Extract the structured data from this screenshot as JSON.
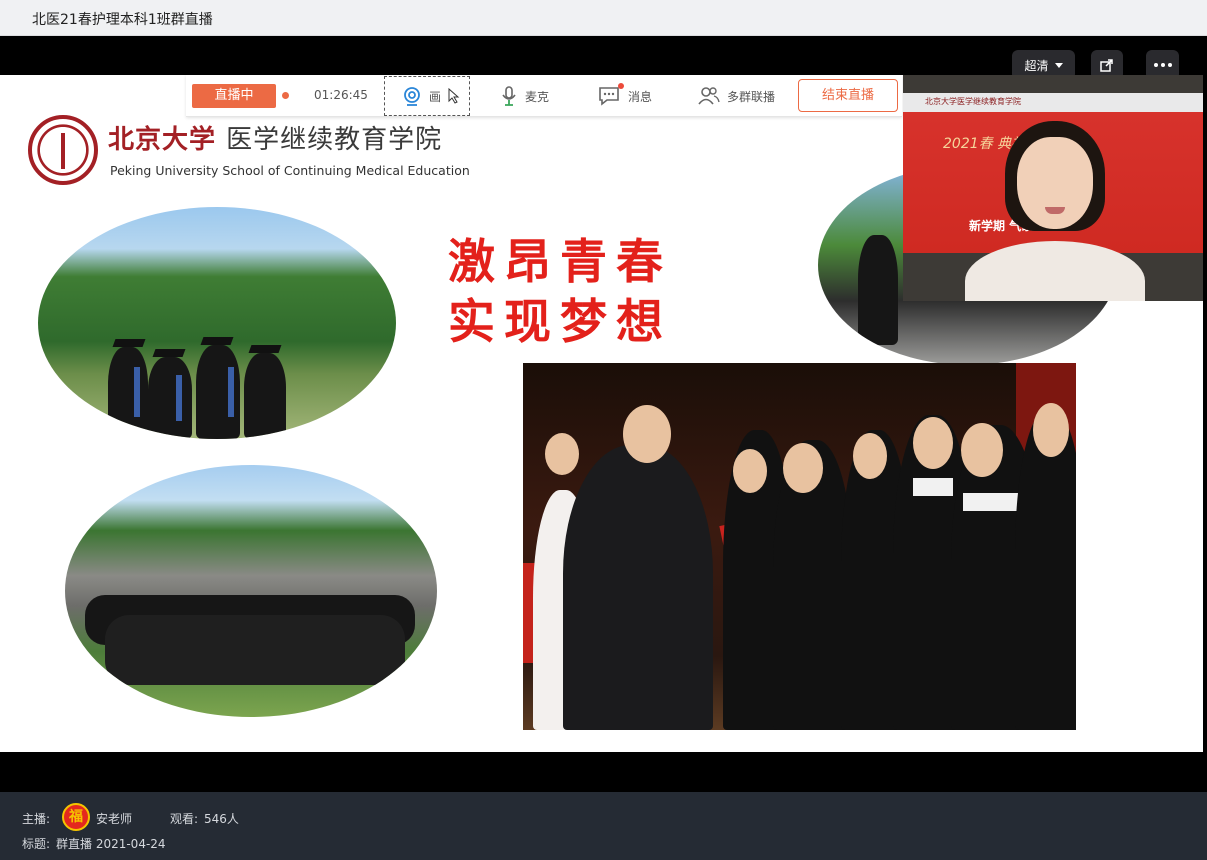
{
  "window": {
    "title": "北医21春护理本科1班群直播"
  },
  "player_controls": {
    "quality_label": "超清",
    "share_icon": "share-window-icon",
    "more_icon": "more-dots-icon"
  },
  "live_toolbar": {
    "status_label": "直播中",
    "elapsed_time": "01:26:45",
    "camera_label": "画",
    "mic_label": "麦克",
    "message_label": "消息",
    "multi_group_label": "多群联播",
    "end_label": "结束直播",
    "accent_color": "#ec6a44"
  },
  "slide": {
    "institution_cn_name": "北京大学",
    "institution_cn_dept": "医学继续教育学院",
    "institution_en": "Peking University School of Continuing Medical Education",
    "slogan_line1": "激昂青春",
    "slogan_line2": "实现梦想",
    "slogan_color": "#e3211b"
  },
  "webcam": {
    "screen_header": "北京大学医学继续教育学院",
    "banner_text": "2021春     典礼\"",
    "banner_sub": "新学期          气象"
  },
  "info": {
    "host_label": "主播:",
    "host_name": "安老师",
    "avatar_char": "福",
    "viewers_label": "观看:",
    "viewers_count": "546人",
    "title_label": "标题:",
    "title_value": "群直播 2021-04-24"
  }
}
